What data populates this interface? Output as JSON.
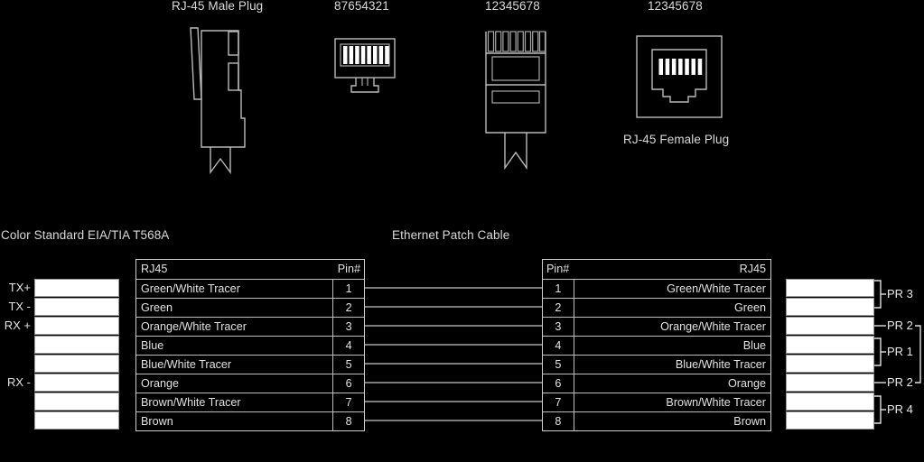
{
  "figures": {
    "male_plug_side": {
      "caption": "RJ-45 Male Plug"
    },
    "male_plug_front": {
      "pin_order": "87654321"
    },
    "male_plug_top": {
      "pin_order": "12345678"
    },
    "female_jack": {
      "pin_order": "12345678",
      "caption": "RJ-45 Female Plug"
    }
  },
  "sections": {
    "color_standard": "Color Standard EIA/TIA T568A",
    "patch_cable": "Ethernet Patch Cable"
  },
  "left_table": {
    "header": {
      "name": "RJ45",
      "pin": "Pin#"
    },
    "rows": [
      {
        "name": "Green/White Tracer",
        "pin": "1"
      },
      {
        "name": "Green",
        "pin": "2"
      },
      {
        "name": "Orange/White Tracer",
        "pin": "3"
      },
      {
        "name": "Blue",
        "pin": "4"
      },
      {
        "name": "Blue/White Tracer",
        "pin": "5"
      },
      {
        "name": "Orange",
        "pin": "6"
      },
      {
        "name": "Brown/White Tracer",
        "pin": "7"
      },
      {
        "name": "Brown",
        "pin": "8"
      }
    ]
  },
  "right_table": {
    "header": {
      "pin": "Pin#",
      "name": "RJ45"
    },
    "rows": [
      {
        "pin": "1",
        "name": "Green/White Tracer"
      },
      {
        "pin": "2",
        "name": "Green"
      },
      {
        "pin": "3",
        "name": "Orange/White Tracer"
      },
      {
        "pin": "4",
        "name": "Blue"
      },
      {
        "pin": "5",
        "name": "Blue/White Tracer"
      },
      {
        "pin": "6",
        "name": "Orange"
      },
      {
        "pin": "7",
        "name": "Brown/White Tracer"
      },
      {
        "pin": "8",
        "name": "Brown"
      }
    ]
  },
  "left_signals": [
    "TX+",
    "TX -",
    "RX +",
    "",
    "",
    "RX -",
    "",
    ""
  ],
  "right_pairs": [
    {
      "label": "PR 3"
    },
    {
      "label": "PR 2"
    },
    {
      "label": "PR 1"
    },
    {
      "label": "PR 2"
    },
    {
      "label": "PR 4"
    }
  ],
  "colors": {
    "background": "#000000",
    "line": "#b9b9b9",
    "text": "#e2e2e2",
    "conductor": "#ffffff"
  }
}
